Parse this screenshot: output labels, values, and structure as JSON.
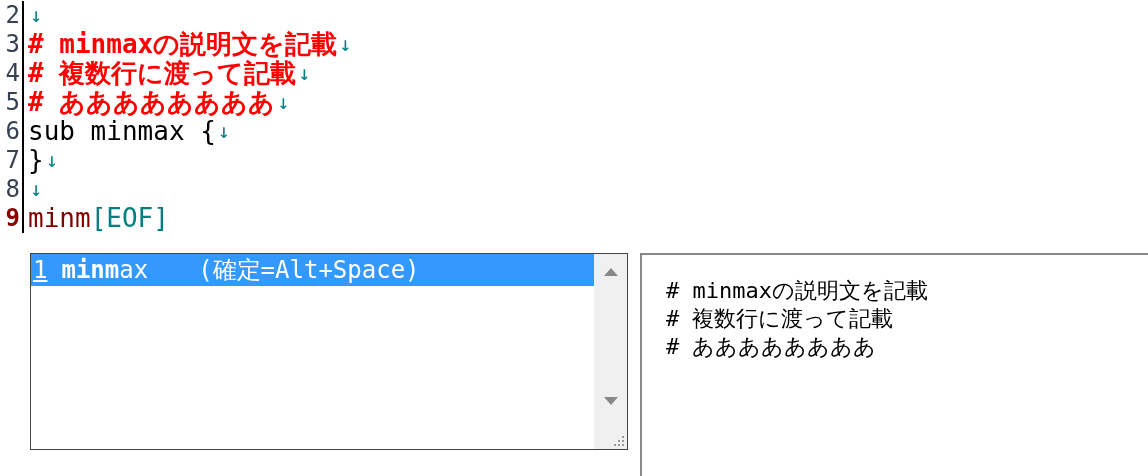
{
  "editor": {
    "lines": [
      {
        "number": "2",
        "kind": "code",
        "eol": "↓",
        "current": false
      },
      {
        "number": "3",
        "kind": "comment",
        "text": "# minmaxの説明文を記載",
        "eol": "↓",
        "current": false
      },
      {
        "number": "4",
        "kind": "comment",
        "text": "# 複数行に渡って記載",
        "eol": "↓",
        "current": false
      },
      {
        "number": "5",
        "kind": "comment",
        "text": "# ああああああああ",
        "eol": "↓",
        "current": false
      },
      {
        "number": "6",
        "kind": "code",
        "text": "sub minmax {",
        "eol": "↓",
        "current": false
      },
      {
        "number": "7",
        "kind": "code",
        "text": "}",
        "eol": "↓",
        "current": false
      },
      {
        "number": "8",
        "kind": "code",
        "eol": "↓",
        "current": false
      },
      {
        "number": "9",
        "kind": "code",
        "text": "minm",
        "eol": "[EOF]",
        "current": true
      }
    ]
  },
  "completion": {
    "items": [
      {
        "number": "1",
        "label": "**minm**ax",
        "hint": "(確定=Alt+Space)",
        "selected": true
      }
    ]
  },
  "description": {
    "lines": [
      "# minmaxの説明文を記載",
      "# 複数行に渡って記載",
      "# ああああああああ"
    ]
  }
}
